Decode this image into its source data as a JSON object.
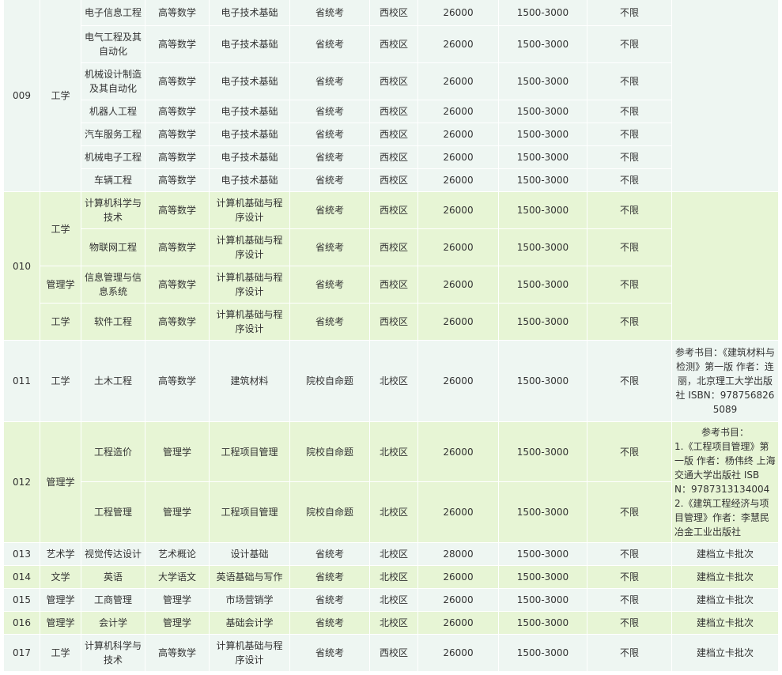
{
  "colors": {
    "row_light": "#eef6f2",
    "row_green": "#e7f5d5",
    "border": "#ffffff",
    "text": "#333333"
  },
  "groups": [
    {
      "code": "009",
      "shade": "a",
      "notes": [],
      "rows": [
        {
          "cat": "工学",
          "major": "电子信息工程",
          "subj1": "高等数学",
          "subj2": "电子技术基础",
          "exam": "省统考",
          "campus": "西校区",
          "fee": "26000",
          "range": "1500-3000",
          "limit": "不限",
          "h": 33
        },
        {
          "major": "电气工程及其自动化",
          "subj1": "高等数学",
          "subj2": "电子技术基础",
          "exam": "省统考",
          "campus": "西校区",
          "fee": "26000",
          "range": "1500-3000",
          "limit": "不限",
          "h": 47
        },
        {
          "major": "机械设计制造及其自动化",
          "subj1": "高等数学",
          "subj2": "电子技术基础",
          "exam": "省统考",
          "campus": "西校区",
          "fee": "26000",
          "range": "1500-3000",
          "limit": "不限",
          "h": 47
        },
        {
          "major": "机器人工程",
          "subj1": "高等数学",
          "subj2": "电子技术基础",
          "exam": "省统考",
          "campus": "西校区",
          "fee": "26000",
          "range": "1500-3000",
          "limit": "不限",
          "h": 29
        },
        {
          "major": "汽车服务工程",
          "subj1": "高等数学",
          "subj2": "电子技术基础",
          "exam": "省统考",
          "campus": "西校区",
          "fee": "26000",
          "range": "1500-3000",
          "limit": "不限",
          "h": 29
        },
        {
          "major": "机械电子工程",
          "subj1": "高等数学",
          "subj2": "电子技术基础",
          "exam": "省统考",
          "campus": "西校区",
          "fee": "26000",
          "range": "1500-3000",
          "limit": "不限",
          "h": 29
        },
        {
          "major": "车辆工程",
          "subj1": "高等数学",
          "subj2": "电子技术基础",
          "exam": "省统考",
          "campus": "西校区",
          "fee": "26000",
          "range": "1500-3000",
          "limit": "不限",
          "h": 29
        }
      ]
    },
    {
      "code": "010",
      "shade": "b",
      "notes": [],
      "rows": [
        {
          "cat": "工学",
          "catSpan": 2,
          "major": "计算机科学与技术",
          "subj1": "高等数学",
          "subj2": "计算机基础与程序设计",
          "exam": "省统考",
          "campus": "西校区",
          "fee": "26000",
          "range": "1500-3000",
          "limit": "不限",
          "h": 47
        },
        {
          "major": "物联网工程",
          "subj1": "高等数学",
          "subj2": "计算机基础与程序设计",
          "exam": "省统考",
          "campus": "西校区",
          "fee": "26000",
          "range": "1500-3000",
          "limit": "不限",
          "h": 47
        },
        {
          "cat": "管理学",
          "major": "信息管理与信息系统",
          "subj1": "高等数学",
          "subj2": "计算机基础与程序设计",
          "exam": "省统考",
          "campus": "西校区",
          "fee": "26000",
          "range": "1500-3000",
          "limit": "不限",
          "h": 47
        },
        {
          "cat": "工学",
          "major": "软件工程",
          "subj1": "高等数学",
          "subj2": "计算机基础与程序设计",
          "exam": "省统考",
          "campus": "西校区",
          "fee": "26000",
          "range": "1500-3000",
          "limit": "不限",
          "h": 47
        }
      ]
    },
    {
      "code": "011",
      "shade": "a",
      "notes": [
        "参考书目：《建筑材料与检测》第一版 作者：连丽，北京理工大学出版社 ISBN：9787568265089"
      ],
      "rows": [
        {
          "cat": "工学",
          "major": "土木工程",
          "subj1": "高等数学",
          "subj2": "建筑材料",
          "exam": "院校自命题",
          "campus": "北校区",
          "fee": "26000",
          "range": "1500-3000",
          "limit": "不限",
          "h": 103
        }
      ]
    },
    {
      "code": "012",
      "shade": "b",
      "notes": [
        "参考书目：",
        "1.《工程项目管理》第一版 作者：杨伟终 上海交通大学出版社 ISBN：9787313134004",
        "2.《建筑工程经济与项目管理》作者：李慧民 冶金工业出版社"
      ],
      "rows": [
        {
          "cat": "管理学",
          "major": "工程造价",
          "subj1": "管理学",
          "subj2": "工程项目管理",
          "exam": "院校自命题",
          "campus": "北校区",
          "fee": "26000",
          "range": "1500-3000",
          "limit": "不限",
          "h": 76
        },
        {
          "major": "工程管理",
          "subj1": "管理学",
          "subj2": "工程项目管理",
          "exam": "院校自命题",
          "campus": "北校区",
          "fee": "26000",
          "range": "1500-3000",
          "limit": "不限",
          "h": 77
        }
      ]
    },
    {
      "code": "013",
      "shade": "a",
      "notes": [
        "建档立卡批次"
      ],
      "rows": [
        {
          "cat": "艺术学",
          "major": "视觉传达设计",
          "subj1": "艺术概论",
          "subj2": "设计基础",
          "exam": "省统考",
          "campus": "北校区",
          "fee": "28000",
          "range": "1500-3000",
          "limit": "不限",
          "h": 29
        }
      ]
    },
    {
      "code": "014",
      "shade": "b",
      "notes": [
        "建档立卡批次"
      ],
      "rows": [
        {
          "cat": "文学",
          "major": "英语",
          "subj1": "大学语文",
          "subj2": "英语基础与写作",
          "exam": "省统考",
          "campus": "北校区",
          "fee": "26000",
          "range": "1500-3000",
          "limit": "不限",
          "h": 29
        }
      ]
    },
    {
      "code": "015",
      "shade": "a",
      "notes": [
        "建档立卡批次"
      ],
      "rows": [
        {
          "cat": "管理学",
          "major": "工商管理",
          "subj1": "管理学",
          "subj2": "市场营销学",
          "exam": "省统考",
          "campus": "北校区",
          "fee": "26000",
          "range": "1500-3000",
          "limit": "不限",
          "h": 29
        }
      ]
    },
    {
      "code": "016",
      "shade": "b",
      "notes": [
        "建档立卡批次"
      ],
      "rows": [
        {
          "cat": "管理学",
          "major": "会计学",
          "subj1": "管理学",
          "subj2": "基础会计学",
          "exam": "省统考",
          "campus": "北校区",
          "fee": "26000",
          "range": "1500-3000",
          "limit": "不限",
          "h": 29
        }
      ]
    },
    {
      "code": "017",
      "shade": "a",
      "notes": [
        "建档立卡批次"
      ],
      "rows": [
        {
          "cat": "工学",
          "major": "计算机科学与技术",
          "subj1": "高等数学",
          "subj2": "计算机基础与程序设计",
          "exam": "省统考",
          "campus": "西校区",
          "fee": "26000",
          "range": "1500-3000",
          "limit": "不限",
          "h": 47
        }
      ]
    }
  ]
}
